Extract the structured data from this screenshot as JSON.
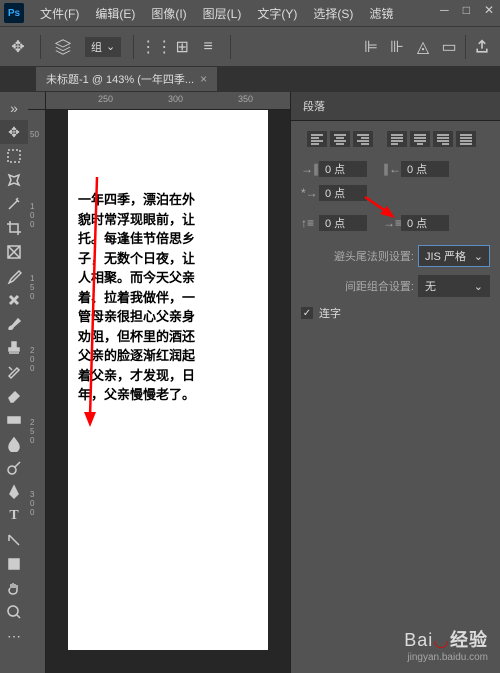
{
  "menubar": {
    "items": [
      "文件(F)",
      "编辑(E)",
      "图像(I)",
      "图层(L)",
      "文字(Y)",
      "选择(S)",
      "滤镜"
    ]
  },
  "optbar": {
    "group_label": "组"
  },
  "doctab": {
    "title": "未标题-1 @ 143% (一年四季..."
  },
  "ruler_h": [
    "250",
    "300",
    "350"
  ],
  "ruler_v": [
    "50",
    "100",
    "150",
    "200",
    "250",
    "300"
  ],
  "document_text": "      一年四季，漂泊在外\n貌时常浮现眼前，让\n托。每逢佳节倍思乡\n子，无数个日夜，让\n人相聚。而今天父亲\n着、拉着我做伴，一\n管母亲很担心父亲身\n劝阻，但杯里的酒还\n父亲的脸逐渐红润起\n着父亲，才发现，日\n年，父亲慢慢老了。",
  "panel": {
    "tab": "段落",
    "indent_values": [
      "0 点",
      "0 点",
      "0 点",
      "0 点",
      "0 点"
    ],
    "setting1_label": "避头尾法则设置:",
    "setting1_value": "JIS 严格",
    "setting2_label": "间距组合设置:",
    "setting2_value": "无",
    "ligature_label": "连字"
  },
  "watermark": {
    "brand_prefix": "Bai",
    "brand_suffix": "经验",
    "url": "jingyan.baidu.com"
  }
}
